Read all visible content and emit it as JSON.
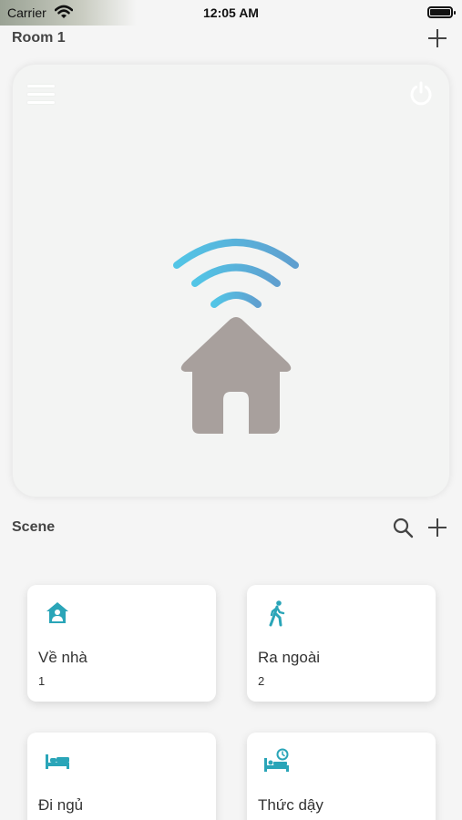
{
  "status_bar": {
    "carrier": "Carrier",
    "time": "12:05 AM"
  },
  "room": {
    "title": "Room 1",
    "add_icon": "plus-icon",
    "menu_icon": "hamburger-icon",
    "power_icon": "power-icon",
    "illustration": "smart-home-wifi-icon"
  },
  "scene": {
    "title": "Scene",
    "search_icon": "search-icon",
    "add_icon": "plus-icon",
    "items": [
      {
        "name": "Về nhà",
        "count": "1",
        "icon": "home-user-icon"
      },
      {
        "name": "Ra ngoài",
        "count": "2",
        "icon": "walking-icon"
      },
      {
        "name": "Đi ngủ",
        "count": "",
        "icon": "bed-icon"
      },
      {
        "name": "Thức dậy",
        "count": "",
        "icon": "bed-alarm-icon"
      }
    ]
  },
  "colors": {
    "accent": "#2aa5b8",
    "house": "#a8a09d",
    "wifi_start": "#52c5e6",
    "wifi_end": "#5f9fcf",
    "background": "#f5f5f5"
  }
}
